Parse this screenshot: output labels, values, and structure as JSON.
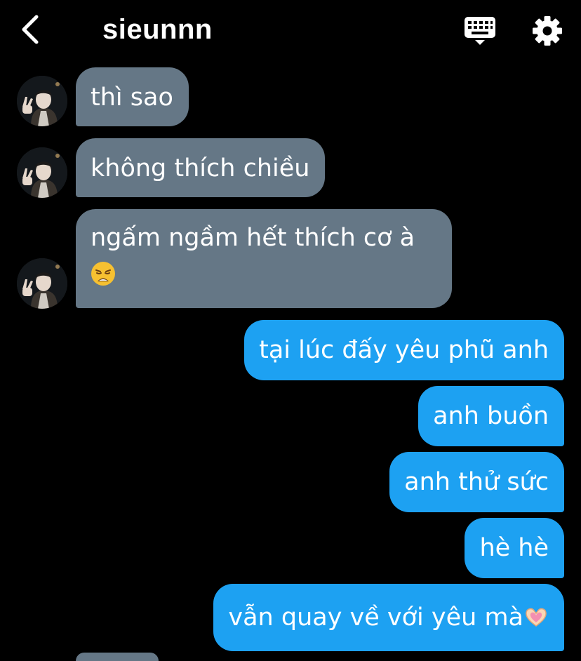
{
  "header": {
    "title": "sieunnn",
    "back_icon": "chevron-left-icon",
    "keyboard_icon": "keyboard-icon",
    "settings_icon": "gear-icon"
  },
  "messages": [
    {
      "direction": "incoming",
      "text": "thì sao"
    },
    {
      "direction": "incoming",
      "text": "không thích chiều"
    },
    {
      "direction": "incoming",
      "text": "ngấm ngầm hết thích cơ à",
      "emoji": "weary-face"
    },
    {
      "direction": "outgoing",
      "text": "tại lúc đấy yêu phũ anh"
    },
    {
      "direction": "outgoing",
      "text": "anh buồn"
    },
    {
      "direction": "outgoing",
      "text": "anh thử sức"
    },
    {
      "direction": "outgoing",
      "text": "hè hè"
    },
    {
      "direction": "outgoing",
      "text": "vẫn quay về với yêu mà",
      "emoji": "heart-hands"
    }
  ],
  "colors": {
    "background": "#000000",
    "incoming_bubble": "#657786",
    "outgoing_bubble": "#1da1f2",
    "text": "#ffffff"
  }
}
